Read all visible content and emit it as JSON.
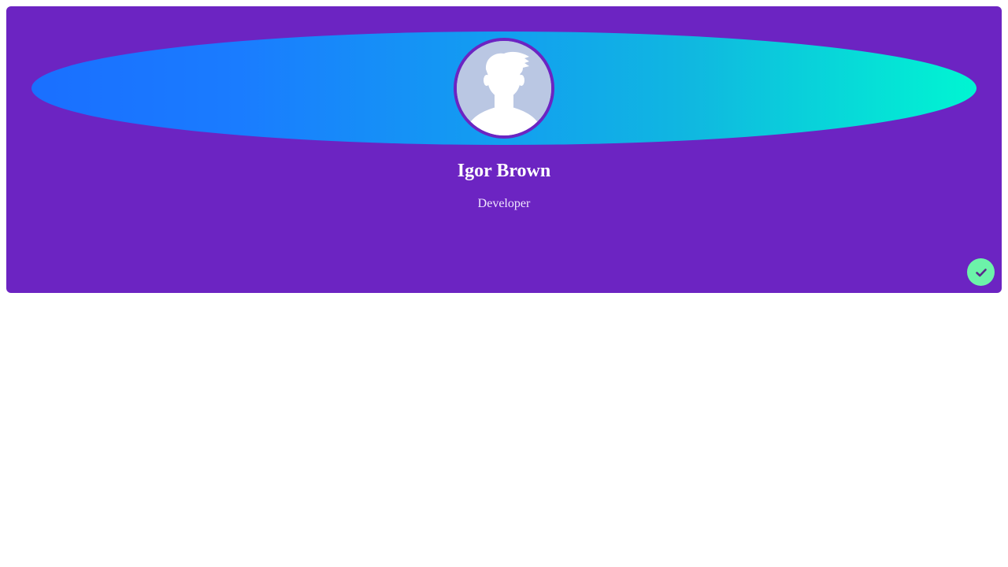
{
  "profile": {
    "name": "Igor Brown",
    "role": "Developer"
  },
  "icons": {
    "avatar": "user-silhouette-icon",
    "action": "check-icon"
  },
  "colors": {
    "card_background": "#6c24c2",
    "banner_gradient_start": "#1a6fff",
    "banner_gradient_end": "#00f5d2",
    "avatar_background": "#bac7e3",
    "action_button": "#6cf3a9",
    "text": "#ffffff"
  }
}
